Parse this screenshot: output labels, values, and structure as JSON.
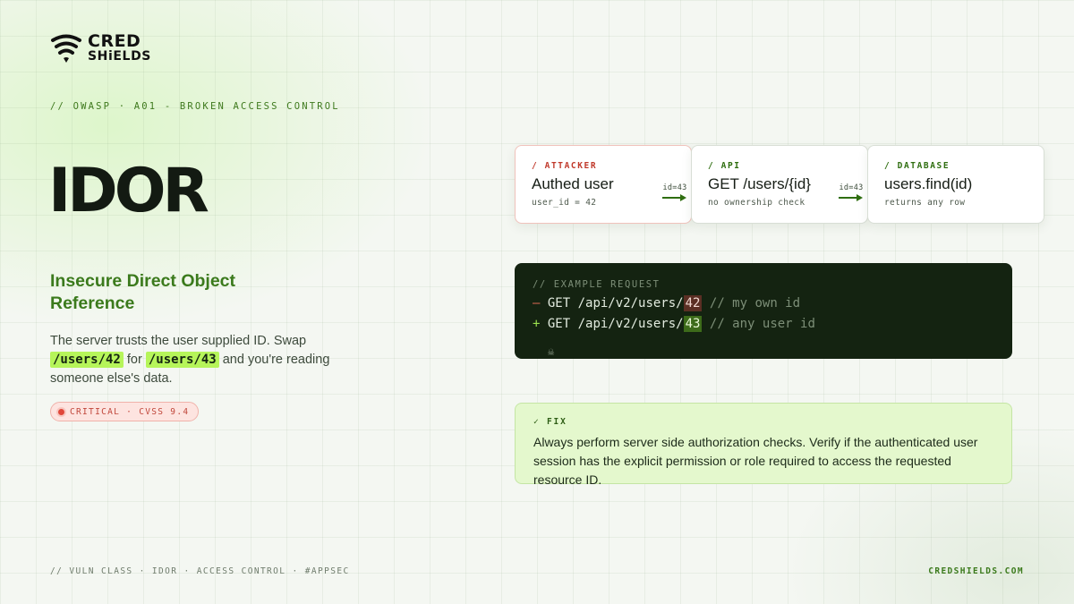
{
  "brand": {
    "line1": "CRED",
    "line2": "SHiELDS",
    "logo_icon": "shield-wifi-icon"
  },
  "kicker": "// OWASP · A01 - BROKEN ACCESS CONTROL",
  "title": "IDOR",
  "subtitle": "Insecure Direct Object Reference",
  "description": {
    "part1": "The server trusts the user supplied ID. Swap ",
    "code1": "/users/42",
    "part2": " for ",
    "code2": "/users/43",
    "part3": " and you're reading someone else's data."
  },
  "badge": {
    "text": "CRITICAL · CVSS 9.4",
    "color": "#e0473a"
  },
  "flow": {
    "attacker": {
      "label": "/ ATTACKER",
      "name": "Authed user",
      "note": "user_id = 42"
    },
    "arrow1": {
      "label": "id=43"
    },
    "api": {
      "label": "/ API",
      "name": "GET /users/{id}",
      "note": "no ownership check"
    },
    "arrow2": {
      "label": "id=43"
    },
    "database": {
      "label": "/ DATABASE",
      "name": "users.find(id)",
      "note": "returns any row"
    }
  },
  "code_example": {
    "header": "// EXAMPLE REQUEST",
    "removed": {
      "sign": "—",
      "request": "GET /api/v2/users/",
      "id": "42",
      "comment": "// my own id"
    },
    "added": {
      "sign": "+",
      "request": "GET /api/v2/users/",
      "id": "43",
      "comment": "// any user id"
    },
    "icon": "skull-icon"
  },
  "fix": {
    "label": "✓ FIX",
    "text": "Always perform server side authorization checks. Verify if the authenticated user session has the explicit permission or role required to access the requested resource ID."
  },
  "footer": {
    "left": "// VULN CLASS · IDOR · ACCESS CONTROL · #APPSEC",
    "right": "CREDSHIELDS.COM"
  },
  "colors": {
    "accent_green": "#3b7a1c",
    "highlight": "#b6f55a",
    "danger": "#c0392b",
    "code_bg": "#142311"
  }
}
